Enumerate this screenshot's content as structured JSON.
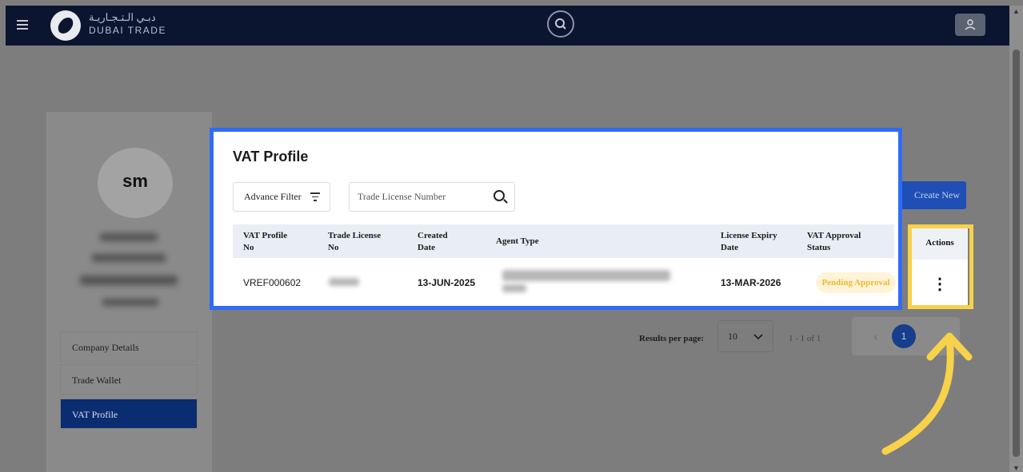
{
  "header": {
    "logo_ar": "دبـي الـتـجـاريـة",
    "logo_en": "DUBAI TRADE"
  },
  "profile": {
    "initials": "sm"
  },
  "sidebar": {
    "items": [
      {
        "label": "Company Details",
        "active": false
      },
      {
        "label": "Trade Wallet",
        "active": false
      },
      {
        "label": "VAT Profile",
        "active": true
      }
    ]
  },
  "modal": {
    "title": "VAT Profile",
    "advance_filter_label": "Advance Filter",
    "search_placeholder": "Trade License Number",
    "create_new_label": "Create New",
    "columns": [
      {
        "line1": "VAT Profile",
        "line2": "No"
      },
      {
        "line1": "Trade License",
        "line2": "No"
      },
      {
        "line1": "Created",
        "line2": "Date"
      },
      {
        "line1": "Agent Type",
        "line2": ""
      },
      {
        "line1": "License Expiry",
        "line2": "Date"
      },
      {
        "line1": "VAT Approval",
        "line2": "Status"
      }
    ],
    "actions_header": "Actions",
    "rows": [
      {
        "vat_profile_no": "VREF000602",
        "created_date": "13-JUN-2025",
        "license_expiry_date": "13-MAR-2026",
        "status": "Pending Approval"
      }
    ]
  },
  "pagination": {
    "results_per_page_label": "Results per page:",
    "results_per_page_value": "10",
    "range": "1 - 1 of 1",
    "current_page": "1",
    "prev_icon": "‹"
  },
  "colors": {
    "highlight": "#f7d24a",
    "modal_border": "#2f6bf6",
    "topbar": "#0b1530",
    "active_nav": "#0a2d72",
    "status_text": "#f2b72c"
  }
}
